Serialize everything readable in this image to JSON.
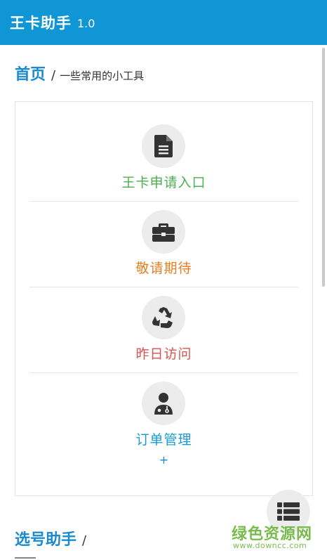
{
  "header": {
    "title": "王卡助手",
    "version": "1.0",
    "background": "#1196d5"
  },
  "breadcrumb": {
    "home": "首页",
    "separator": "/",
    "subtitle": "一些常用的小工具"
  },
  "tools": [
    {
      "label": "王卡申请入口",
      "icon": "document-icon",
      "color": "#4caf50"
    },
    {
      "label": "敬请期待",
      "icon": "briefcase-icon",
      "color": "#e67e22"
    },
    {
      "label": "昨日访问",
      "icon": "recycle-icon",
      "color": "#d9534f"
    },
    {
      "label": "订单管理",
      "icon": "user-md-icon",
      "color": "#1a9bd7"
    }
  ],
  "more_symbol": "+",
  "fab": {
    "icon": "list-icon"
  },
  "section2": {
    "title": "选号助手",
    "separator": "/"
  },
  "watermark": {
    "title": "绿色资源网",
    "url": "www.downcc.com"
  }
}
